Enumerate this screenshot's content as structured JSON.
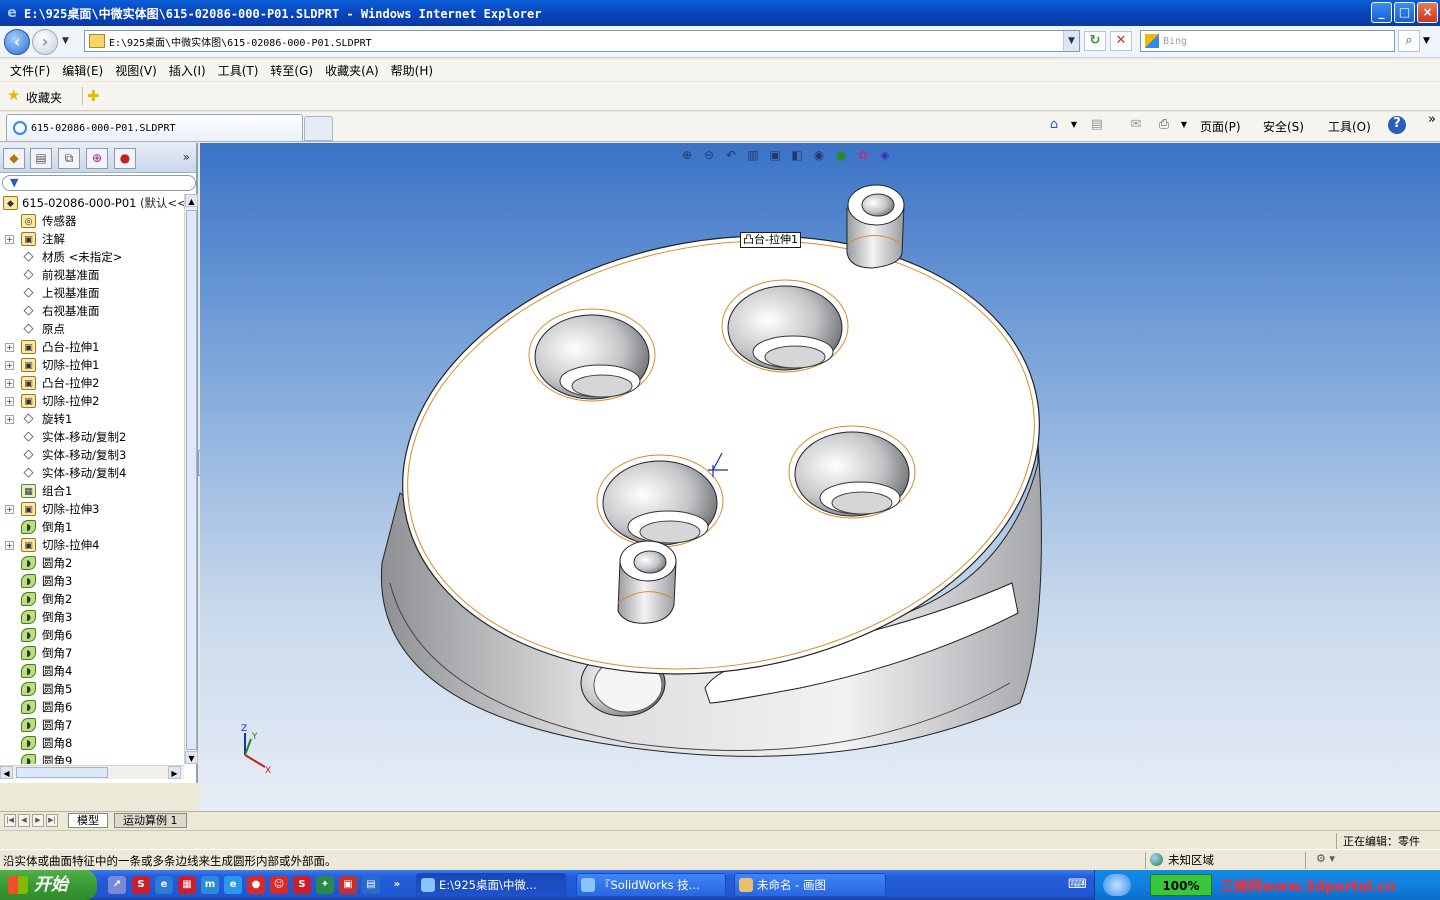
{
  "window": {
    "title": "E:\\925桌面\\中微实体图\\615-02086-000-P01.SLDPRT - Windows Internet Explorer",
    "buttons": [
      "_",
      "□",
      "×"
    ]
  },
  "address": {
    "url": "E:\\925桌面\\中微实体图\\615-02086-000-P01.SLDPRT",
    "search_placeholder": "Bing"
  },
  "menu": [
    "文件(F)",
    "编辑(E)",
    "视图(V)",
    "插入(I)",
    "工具(T)",
    "转至(G)",
    "收藏夹(A)",
    "帮助(H)"
  ],
  "favorites": {
    "label": "收藏夹"
  },
  "tabs": {
    "active": "615-02086-000-P01.SLDPRT"
  },
  "command_bar": {
    "page": "页面(P)",
    "safety": "安全(S)",
    "tools": "工具(O)"
  },
  "tree": {
    "root": "615-02086-000-P01",
    "root_config": "(默认<<默",
    "items": [
      {
        "label": "传感器",
        "icon": "sensor-icon",
        "expandable": false,
        "kind": "sensor"
      },
      {
        "label": "注解",
        "icon": "annotation-icon",
        "expandable": true,
        "kind": "boss"
      },
      {
        "label": "材质 <未指定>",
        "icon": "material-icon",
        "expandable": false,
        "kind": "plane"
      },
      {
        "label": "前视基准面",
        "icon": "plane-icon",
        "expandable": false,
        "kind": "plane"
      },
      {
        "label": "上视基准面",
        "icon": "plane-icon",
        "expandable": false,
        "kind": "plane"
      },
      {
        "label": "右视基准面",
        "icon": "plane-icon",
        "expandable": false,
        "kind": "plane"
      },
      {
        "label": "原点",
        "icon": "origin-icon",
        "expandable": false,
        "kind": "plane"
      },
      {
        "label": "凸台-拉伸1",
        "icon": "extrude-icon",
        "expandable": true,
        "kind": "boss"
      },
      {
        "label": "切除-拉伸1",
        "icon": "cut-icon",
        "expandable": true,
        "kind": "boss"
      },
      {
        "label": "凸台-拉伸2",
        "icon": "extrude-icon",
        "expandable": true,
        "kind": "boss"
      },
      {
        "label": "切除-拉伸2",
        "icon": "cut-icon",
        "expandable": true,
        "kind": "boss"
      },
      {
        "label": "旋转1",
        "icon": "revolve-icon",
        "expandable": true,
        "kind": "plane"
      },
      {
        "label": "实体-移动/复制2",
        "icon": "move-copy-icon",
        "expandable": false,
        "kind": "plane"
      },
      {
        "label": "实体-移动/复制3",
        "icon": "move-copy-icon",
        "expandable": false,
        "kind": "plane"
      },
      {
        "label": "实体-移动/复制4",
        "icon": "move-copy-icon",
        "expandable": false,
        "kind": "plane"
      },
      {
        "label": "组合1",
        "icon": "combine-icon",
        "expandable": false,
        "kind": "feat"
      },
      {
        "label": "切除-拉伸3",
        "icon": "cut-icon",
        "expandable": true,
        "kind": "boss"
      },
      {
        "label": "倒角1",
        "icon": "chamfer-icon",
        "expandable": false,
        "kind": "fillet"
      },
      {
        "label": "切除-拉伸4",
        "icon": "cut-icon",
        "expandable": true,
        "kind": "boss"
      },
      {
        "label": "圆角2",
        "icon": "fillet-icon",
        "expandable": false,
        "kind": "fillet"
      },
      {
        "label": "圆角3",
        "icon": "fillet-icon",
        "expandable": false,
        "kind": "fillet"
      },
      {
        "label": "倒角2",
        "icon": "chamfer-icon",
        "expandable": false,
        "kind": "fillet"
      },
      {
        "label": "倒角3",
        "icon": "chamfer-icon",
        "expandable": false,
        "kind": "fillet"
      },
      {
        "label": "倒角6",
        "icon": "chamfer-icon",
        "expandable": false,
        "kind": "fillet"
      },
      {
        "label": "倒角7",
        "icon": "chamfer-icon",
        "expandable": false,
        "kind": "fillet"
      },
      {
        "label": "圆角4",
        "icon": "fillet-icon",
        "expandable": false,
        "kind": "fillet"
      },
      {
        "label": "圆角5",
        "icon": "fillet-icon",
        "expandable": false,
        "kind": "fillet"
      },
      {
        "label": "圆角6",
        "icon": "fillet-icon",
        "expandable": false,
        "kind": "fillet"
      },
      {
        "label": "圆角7",
        "icon": "fillet-icon",
        "expandable": false,
        "kind": "fillet"
      },
      {
        "label": "圆角8",
        "icon": "fillet-icon",
        "expandable": false,
        "kind": "fillet"
      },
      {
        "label": "圆角9",
        "icon": "fillet-icon",
        "expandable": false,
        "kind": "fillet"
      }
    ]
  },
  "viewport": {
    "callout": "凸台-拉伸1",
    "triad": {
      "x": "X",
      "y": "Y",
      "z": "Z"
    }
  },
  "bottom_tabs": [
    "模型",
    "运动算例 1"
  ],
  "edit_status": "正在编辑：零件",
  "status": {
    "message": "沿实体或曲面特征中的一条或多条边线来生成圆形内部或外部面。",
    "zone": "未知区域"
  },
  "taskbar": {
    "start": "开始",
    "tasks": [
      "E:\\925桌面\\中微...",
      "『SolidWorks 技...",
      "未命名 - 画图"
    ],
    "zoom": "100%",
    "watermark": "三维网www.3dportal.cn"
  }
}
